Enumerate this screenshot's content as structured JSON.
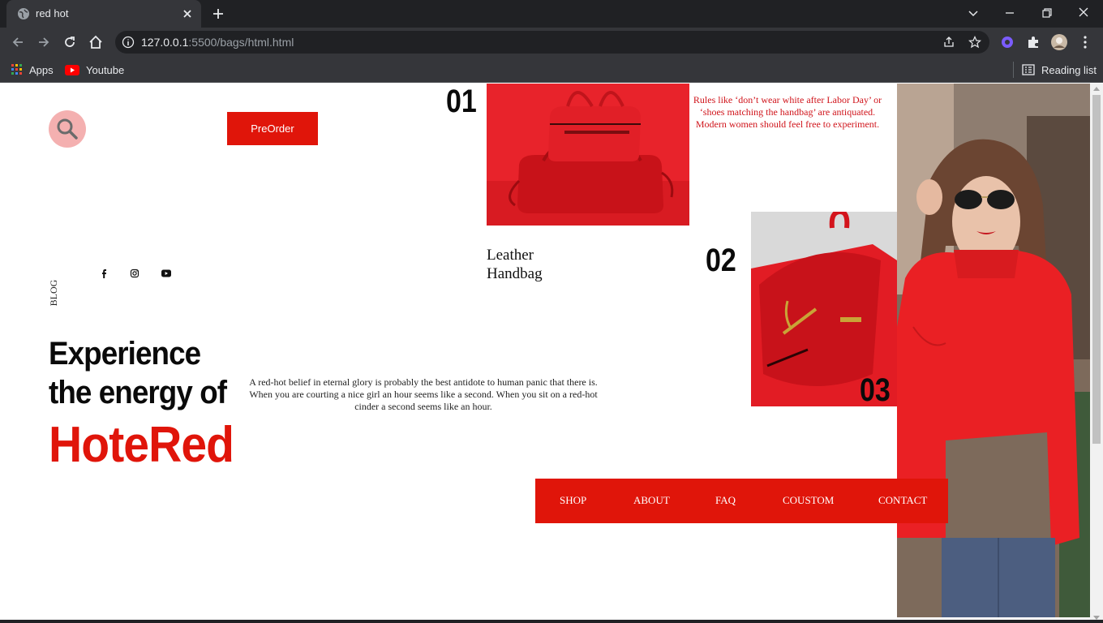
{
  "browser": {
    "tab_title": "red hot",
    "url_host": "127.0.0.1",
    "url_rest": ":5500/bags/html.html",
    "bookmarks": [
      {
        "label": "Apps",
        "icon": "apps-grid-icon"
      },
      {
        "label": "Youtube",
        "icon": "youtube-icon"
      }
    ],
    "reading_list": "Reading list"
  },
  "header": {
    "preorder_label": "PreOrder"
  },
  "sidebar": {
    "blog_label": "BLOG",
    "social_icons": [
      "facebook-icon",
      "instagram-icon",
      "youtube-icon"
    ]
  },
  "hero": {
    "line1": "Experience",
    "line2": "the energy of",
    "brand": "HoteRed",
    "description": "A red-hot belief in eternal glory is probably the best antidote to human panic that there is. When you are courting a nice girl an hour seems like a second. When you sit on a red-hot cinder a second seems like an hour."
  },
  "gallery": {
    "num1": "01",
    "num2": "02",
    "num3": "03",
    "quote": "Rules like ‘don’t wear white after Labor Day’ or ‘shoes matching the handbag’ are antiquated. Modern women should feel free to experiment.",
    "product_name": "Leather Handbag"
  },
  "nav": {
    "items": [
      "SHOP",
      "ABOUT",
      "FAQ",
      "COUSTOM",
      "CONTACT"
    ]
  },
  "colors": {
    "accent": "#e0150a",
    "search_bg": "#f4b0b0",
    "quote_text": "#d0141b"
  }
}
